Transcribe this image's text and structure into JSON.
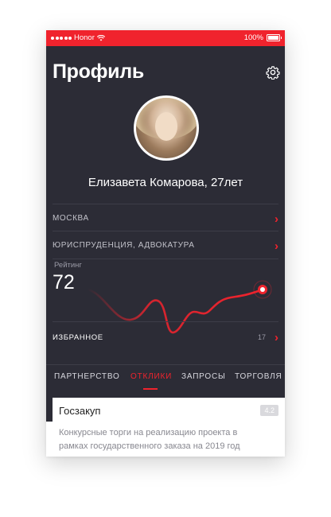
{
  "status_bar": {
    "carrier": "Honor",
    "battery": "100%"
  },
  "header": {
    "title": "Профиль"
  },
  "profile": {
    "name": "Елизавета Комарова, 27лет"
  },
  "rows": [
    {
      "label": "МОСКВА"
    },
    {
      "label": "ЮРИСПРУДЕНЦИЯ, АДВОКАТУРА"
    }
  ],
  "rating": {
    "label": "Рейтинг",
    "value": "72"
  },
  "favorites": {
    "label": "ИЗБРАННОЕ",
    "count": "17"
  },
  "tabs": [
    {
      "label": "ПАРТНЕРСТВО",
      "active": false
    },
    {
      "label": "ОТКЛИКИ",
      "active": true
    },
    {
      "label": "ЗАПРОСЫ",
      "active": false
    },
    {
      "label": "ТОРГОВЛЯ",
      "active": false
    }
  ],
  "card": {
    "title": "Госзакуп",
    "badge": "4.2",
    "description": "Конкурсные торги на реализацию проекта в рамках государственного заказа на 2019 год"
  },
  "colors": {
    "accent": "#f0232d",
    "dark_bg": "#2c2c36"
  },
  "icons": {
    "settings": "gear-icon",
    "wifi": "wifi-icon",
    "chevron": "chevron-right-icon"
  }
}
